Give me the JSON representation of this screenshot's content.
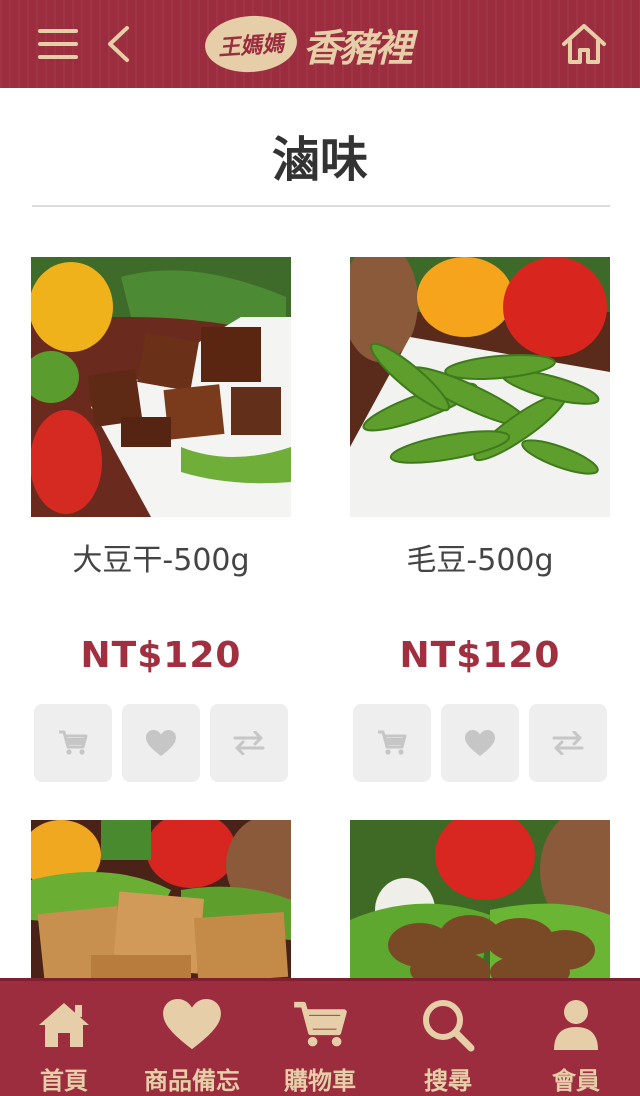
{
  "header": {
    "logo_mark": "王媽媽",
    "logo_text": "香豬裡",
    "menu_icon": "menu-icon",
    "back_icon": "chevron-left-icon",
    "home_icon": "home-icon"
  },
  "page": {
    "title": "滷味"
  },
  "products": [
    {
      "name": "大豆干-500g",
      "price": "NT$120",
      "image": "braised-tofu-photo"
    },
    {
      "name": "毛豆-500g",
      "price": "NT$120",
      "image": "edamame-photo"
    },
    {
      "name": "",
      "price": "",
      "image": "tofu-skin-photo"
    },
    {
      "name": "",
      "price": "",
      "image": "mushroom-photo"
    }
  ],
  "product_actions": [
    "cart-icon",
    "heart-icon",
    "compare-icon"
  ],
  "bottom_nav": {
    "items": [
      {
        "label": "首頁",
        "icon": "home-icon"
      },
      {
        "label": "商品備忘",
        "icon": "heart-icon"
      },
      {
        "label": "購物車",
        "icon": "cart-icon"
      },
      {
        "label": "搜尋",
        "icon": "search-icon"
      },
      {
        "label": "會員",
        "icon": "user-icon"
      }
    ]
  },
  "colors": {
    "brand": "#9b2d3f",
    "accent": "#e6cfa8",
    "price": "#a02f40"
  }
}
